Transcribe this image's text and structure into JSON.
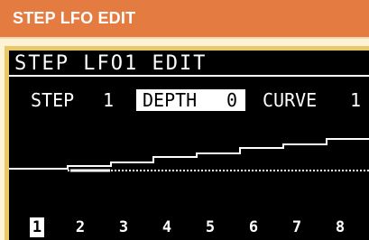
{
  "banner": {
    "title": "STEP LFO EDIT"
  },
  "screen": {
    "title": "STEP LFO1 EDIT",
    "params": {
      "step_label": "STEP",
      "step_value": "1",
      "depth_label": "DEPTH",
      "depth_value": "0",
      "curve_label": "CURVE",
      "curve_value": "1"
    },
    "steps": [
      "1",
      "2",
      "3",
      "4",
      "5",
      "6",
      "7",
      "8"
    ],
    "selected_step": "1"
  },
  "colors": {
    "banner": "#e47b41",
    "page_bg": "#fdf1d6",
    "bezel": "#e8c868",
    "lcd_bg": "#000000",
    "lcd_fg": "#ffffff"
  }
}
